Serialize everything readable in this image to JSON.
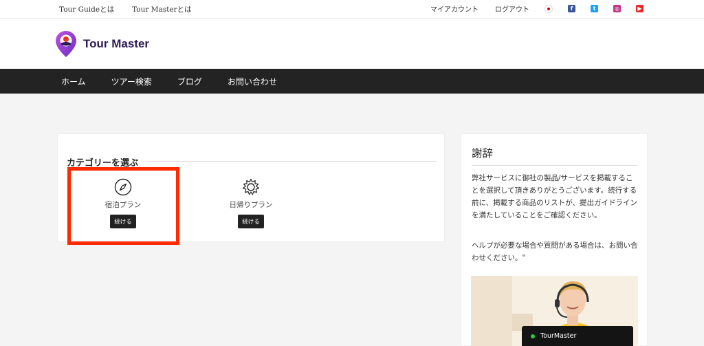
{
  "topbar": {
    "left_links": [
      "Tour Guideとは",
      "Tour Masterとは"
    ],
    "right_links": [
      "マイアカウント",
      "ログアウト"
    ],
    "social_icons": [
      "japan-flag-icon",
      "facebook-icon",
      "twitter-icon",
      "instagram-icon",
      "youtube-icon"
    ]
  },
  "brand": {
    "name": "Tour Master",
    "accent": "#8b3fd1"
  },
  "nav": {
    "items": [
      "ホーム",
      "ツアー検索",
      "ブログ",
      "お問い合わせ"
    ]
  },
  "category": {
    "title": "カテゴリーを選ぶ",
    "items": [
      {
        "name": "宿泊プラン",
        "button": "続ける",
        "icon": "compass-icon"
      },
      {
        "name": "日帰りプラン",
        "button": "続ける",
        "icon": "sun-icon"
      }
    ]
  },
  "sidebar": {
    "title": "謝辞",
    "paragraphs": [
      "弊社サービスに御社の製品/サービスを掲載することを選択して頂きありがとうございます。続行する前に、掲載する商品のリストが、提出ガイドラインを満たしていることをご確認ください。",
      "ヘルプが必要な場合や質問がある場合は、お問い合わせください。\""
    ]
  },
  "chat": {
    "label": "TourMaster",
    "status_color": "#2ecc40"
  },
  "highlight_color": "#ff2a00"
}
